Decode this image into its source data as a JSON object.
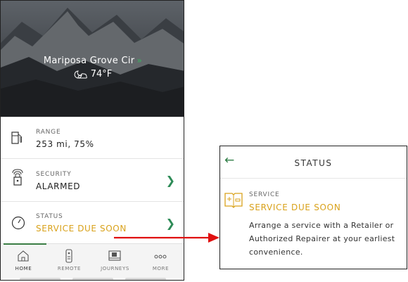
{
  "header": {
    "location": "Mariposa Grove Cir",
    "location_chevron": "»",
    "temperature": "74°F",
    "weather_icon": "partly-cloudy-night-icon"
  },
  "rows": [
    {
      "label": "RANGE",
      "value": "253 mi, 75%",
      "icon": "fuel-icon"
    },
    {
      "label": "SECURITY",
      "value": "ALARMED",
      "icon": "lock-alarm-icon"
    },
    {
      "label": "STATUS",
      "value": "SERVICE DUE SOON",
      "icon": "gauge-icon"
    }
  ],
  "nav": [
    {
      "label": "HOME",
      "icon": "home-icon"
    },
    {
      "label": "REMOTE",
      "icon": "remote-icon"
    },
    {
      "label": "JOURNEYS",
      "icon": "journeys-icon"
    },
    {
      "label": "MORE",
      "icon": "more-icon"
    }
  ],
  "status_panel": {
    "back_icon": "←",
    "title": "STATUS",
    "service_label": "SERVICE",
    "service_value": "SERVICE DUE SOON",
    "description": "Arrange a service with a Retailer or Authorized Repairer at your earliest convenience."
  },
  "colors": {
    "accent_green": "#2e7d45",
    "warning": "#d9a21b",
    "arrow": "#e01010"
  }
}
